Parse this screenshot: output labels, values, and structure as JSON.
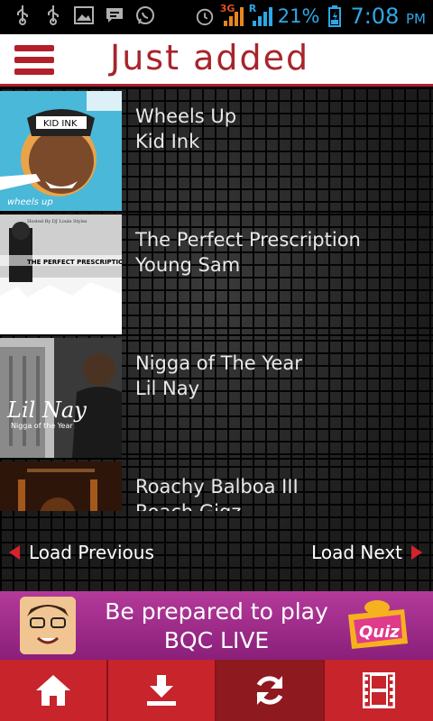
{
  "status_bar": {
    "icons": [
      "usb-icon",
      "usb-icon",
      "image-icon",
      "message-icon",
      "whatsapp-icon"
    ],
    "network_3g": "3G",
    "roaming": "R",
    "battery_percent": "21%",
    "time": "7:08",
    "ampm": "PM",
    "color": "#2ea8e6"
  },
  "header": {
    "title": "Just added",
    "accent_color": "#b3202a"
  },
  "tracks": [
    {
      "title": "Wheels Up",
      "artist": "Kid Ink",
      "cover_text": "KID INK",
      "cover_sub": "wheels up"
    },
    {
      "title": "The Perfect Prescription",
      "artist": "Young Sam",
      "cover_text": "THE PERFECT PRESCRIPTION",
      "cover_sub": "Hosted By DJ Louie Styles"
    },
    {
      "title": "Nigga of The Year",
      "artist": "Lil Nay",
      "cover_text": "Lil Nay",
      "cover_sub": "Nigga of the Year"
    },
    {
      "title": "Roachy Balboa III",
      "artist": "Roach Gigz",
      "cover_text": "",
      "cover_sub": ""
    }
  ],
  "load_nav": {
    "previous_label": "Load Previous",
    "next_label": "Load Next"
  },
  "ad": {
    "line1": "Be prepared to play",
    "line2": "BQC LIVE",
    "logo_text": "Quiz"
  },
  "bottom_nav": [
    {
      "icon": "home-icon",
      "active": false
    },
    {
      "icon": "download-icon",
      "active": false
    },
    {
      "icon": "refresh-icon",
      "active": true
    },
    {
      "icon": "film-icon",
      "active": false
    }
  ]
}
